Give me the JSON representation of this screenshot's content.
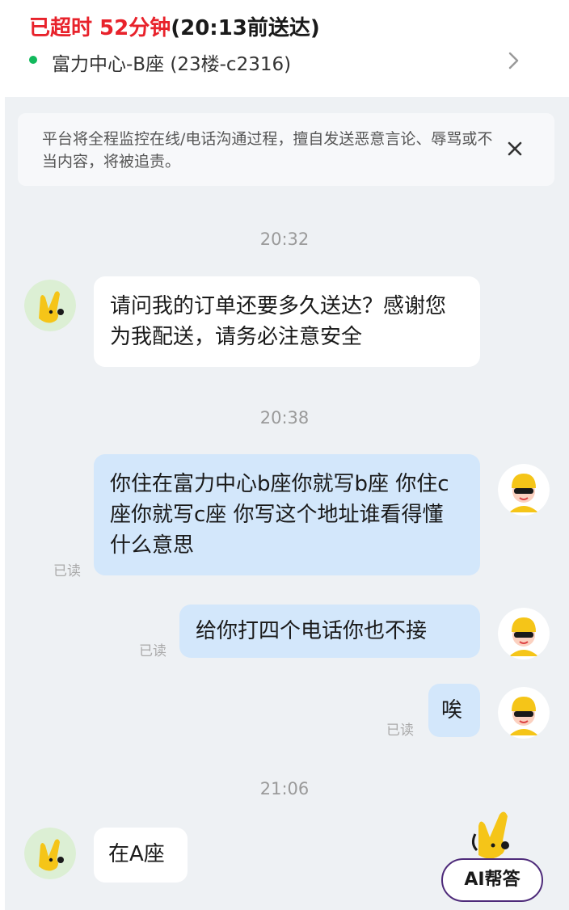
{
  "header": {
    "status_prefix": "已超时 52分钟",
    "status_suffix": "(20:13前送达)",
    "address": "富力中心-B座 (23楼-c2316)"
  },
  "notice": {
    "text": "平台将全程监控在线/电话沟通过程，擅自发送恶意言论、辱骂或不当内容，将被追责。"
  },
  "timestamps": [
    "20:32",
    "20:38",
    "21:06"
  ],
  "messages": [
    {
      "side": "in",
      "text": "请问我的订单还要多久送达？感谢您为我配送，请务必注意安全"
    },
    {
      "side": "out",
      "text": "你住在富力中心b座你就写b座 你住c座你就写c座 你写这个地址谁看得懂什么意思",
      "read": "已读"
    },
    {
      "side": "out",
      "text": "给你打四个电话你也不接",
      "read": "已读"
    },
    {
      "side": "out",
      "text": "唉",
      "read": "已读"
    },
    {
      "side": "in",
      "text": "在A座"
    }
  ],
  "ai_button": {
    "label": "AI帮答"
  },
  "icons": {
    "chevron": "chevron-right-icon",
    "close": "close-icon",
    "status_dot": "online-dot-icon"
  },
  "colors": {
    "alert_red": "#e8222b",
    "online_green": "#11b95c",
    "outgoing_bubble": "#d3e7fb",
    "chat_background": "#eef1f4"
  }
}
